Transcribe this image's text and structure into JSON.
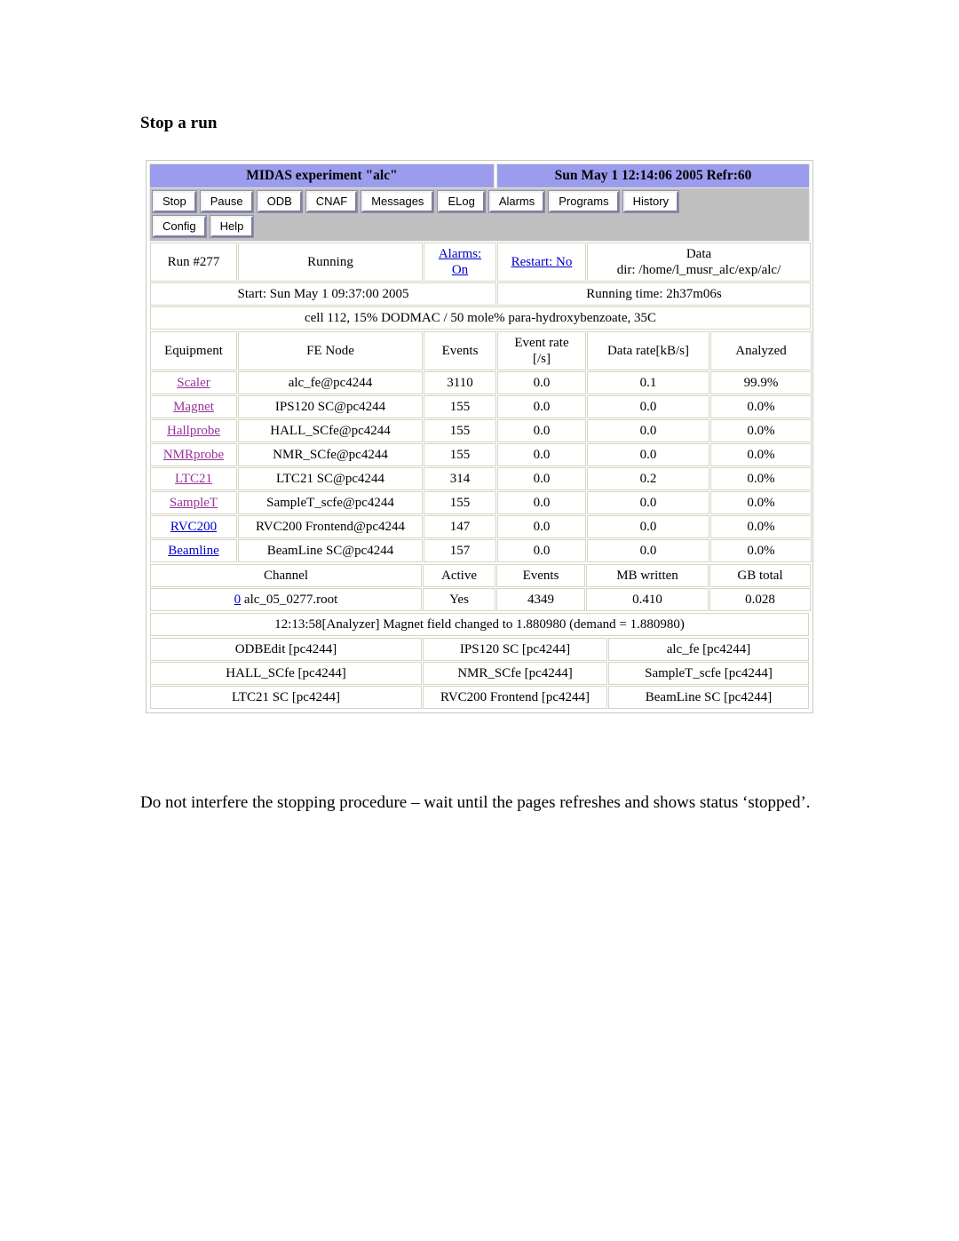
{
  "doc": {
    "heading": "Stop a run",
    "caption": "Do not interfere the stopping procedure – wait until the pages refreshes and shows status ‘stopped’."
  },
  "titlebar": {
    "experiment": "MIDAS experiment \"alc\"",
    "clock": "Sun May 1 12:14:06 2005   Refr:60"
  },
  "buttons": {
    "row1": [
      {
        "label": "Stop",
        "name": "stop-button"
      },
      {
        "label": "Pause",
        "name": "pause-button"
      },
      {
        "label": "ODB",
        "name": "odb-button"
      },
      {
        "label": "CNAF",
        "name": "cnaf-button"
      },
      {
        "label": "Messages",
        "name": "messages-button"
      },
      {
        "label": "ELog",
        "name": "elog-button"
      },
      {
        "label": "Alarms",
        "name": "alarms-button"
      },
      {
        "label": "Programs",
        "name": "programs-button"
      },
      {
        "label": "History",
        "name": "history-button"
      }
    ],
    "row2": [
      {
        "label": "Config",
        "name": "config-button"
      },
      {
        "label": "Help",
        "name": "help-button"
      }
    ]
  },
  "status": {
    "run_number": "Run #277",
    "run_state": "Running",
    "alarms_line1": "Alarms:",
    "alarms_line2": "On",
    "restart": "Restart: No",
    "data_line1": "Data",
    "data_line2": "dir: /home/l_musr_alc/exp/alc/",
    "start": "Start: Sun May 1 09:37:00 2005",
    "running_time": "Running time: 2h37m06s",
    "experiment_description": "cell 112, 15% DODMAC / 50 mole% para-hydroxybenzoate, 35C"
  },
  "equipment_table": {
    "headers": [
      "Equipment",
      "FE Node",
      "Events",
      "Event rate [/s]",
      "Data rate[kB/s]",
      "Analyzed"
    ],
    "header_event_rate_line1": "Event rate",
    "header_event_rate_line2": "[/s]",
    "rows": [
      {
        "equipment": "Scaler",
        "visited": true,
        "fenode": "alc_fe@pc4244",
        "events": "3110",
        "event_rate": "0.0",
        "data_rate": "0.1",
        "analyzed": "99.9%"
      },
      {
        "equipment": "Magnet",
        "visited": true,
        "fenode": "IPS120 SC@pc4244",
        "events": "155",
        "event_rate": "0.0",
        "data_rate": "0.0",
        "analyzed": "0.0%"
      },
      {
        "equipment": "Hallprobe",
        "visited": true,
        "fenode": "HALL_SCfe@pc4244",
        "events": "155",
        "event_rate": "0.0",
        "data_rate": "0.0",
        "analyzed": "0.0%"
      },
      {
        "equipment": "NMRprobe",
        "visited": true,
        "fenode": "NMR_SCfe@pc4244",
        "events": "155",
        "event_rate": "0.0",
        "data_rate": "0.0",
        "analyzed": "0.0%"
      },
      {
        "equipment": "LTC21",
        "visited": true,
        "fenode": "LTC21 SC@pc4244",
        "events": "314",
        "event_rate": "0.0",
        "data_rate": "0.2",
        "analyzed": "0.0%"
      },
      {
        "equipment": "SampleT",
        "visited": true,
        "fenode": "SampleT_scfe@pc4244",
        "events": "155",
        "event_rate": "0.0",
        "data_rate": "0.0",
        "analyzed": "0.0%"
      },
      {
        "equipment": "RVC200",
        "visited": false,
        "fenode": "RVC200 Frontend@pc4244",
        "events": "147",
        "event_rate": "0.0",
        "data_rate": "0.0",
        "analyzed": "0.0%"
      },
      {
        "equipment": "Beamline",
        "visited": false,
        "fenode": "BeamLine SC@pc4244",
        "events": "157",
        "event_rate": "0.0",
        "data_rate": "0.0",
        "analyzed": "0.0%"
      }
    ]
  },
  "channel_table": {
    "headers": [
      "Channel",
      "Active",
      "Events",
      "MB written",
      "GB total"
    ],
    "rows": [
      {
        "index": "0",
        "file": " alc_05_0277.root",
        "active": "Yes",
        "events": "4349",
        "mb_written": "0.410",
        "gb_total": "0.028"
      }
    ]
  },
  "message": "12:13:58[Analyzer] Magnet field changed to 1.880980 (demand = 1.880980)",
  "programs": [
    [
      "ODBEdit [pc4244]",
      "IPS120 SC [pc4244]",
      "alc_fe [pc4244]"
    ],
    [
      "HALL_SCfe [pc4244]",
      "NMR_SCfe [pc4244]",
      "SampleT_scfe [pc4244]"
    ],
    [
      "LTC21 SC [pc4244]",
      "RVC200 Frontend [pc4244]",
      "BeamLine SC [pc4244]"
    ]
  ],
  "colors": {
    "titlebar": "#9c9ceee",
    "running_green": "#00f000",
    "restart_yellow": "#ffff00",
    "link_blue": "#0000cc",
    "link_visited": "#993399",
    "button_bar_grey": "#c0c0c0"
  }
}
